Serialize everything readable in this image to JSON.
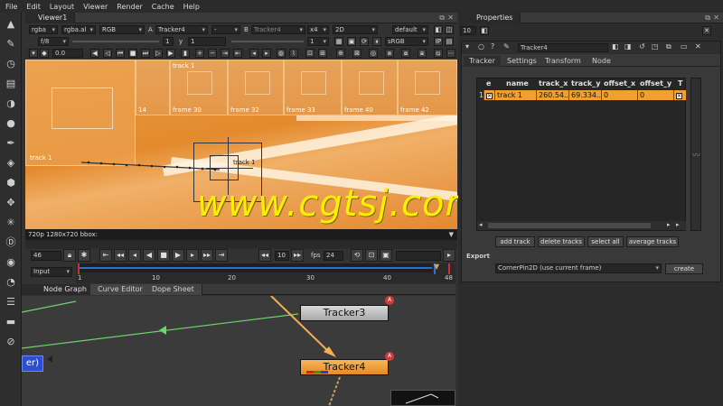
{
  "menu": [
    "File",
    "Edit",
    "Layout",
    "Viewer",
    "Render",
    "Cache",
    "Help"
  ],
  "viewer": {
    "tab_label": "Viewer1",
    "channels": "rgba",
    "alpha_channel": "rgba.al",
    "color": "RGB",
    "input_a_label": "A",
    "input_a": "Tracker4",
    "input_a_op": "-",
    "input_b_label": "B",
    "input_b": "Tracker4",
    "zoom": "x4",
    "view_mode": "2D",
    "lut": "default",
    "fstop": "f/8",
    "frame_a": "1",
    "y_label": "y",
    "y_value": "1",
    "frame_b": "1",
    "colorspace": "sRGB",
    "gain": "0.0",
    "status_text": "720p 1280x720 bbox:",
    "overlay_track_top": "track 1",
    "overlay_track_main": "track 1",
    "overlay_left_label": "track 1"
  },
  "thumbnails": [
    {
      "label": "14"
    },
    {
      "label": "frame 30"
    },
    {
      "label": "frame 32"
    },
    {
      "label": "frame 33"
    },
    {
      "label": "frame 40"
    },
    {
      "label": "frame 42"
    }
  ],
  "transport": {
    "current_frame": "46",
    "step": "10",
    "fps_label": "fps",
    "fps": "24",
    "input_mode": "Input",
    "timeline_ticks": [
      "1",
      "10",
      "20",
      "30",
      "40",
      "48"
    ]
  },
  "nodegraph": {
    "tabs": [
      "Node Graph",
      "Curve Editor",
      "Dope Sheet"
    ],
    "node_tracker3": "Tracker3",
    "node_tracker4": "Tracker4",
    "node_left_label": "er)",
    "badge": "A"
  },
  "properties": {
    "panel_title": "Properties",
    "max_panels": "10",
    "node_name": "Tracker4",
    "tabs": [
      "Tracker",
      "Settings",
      "Transform",
      "Node"
    ],
    "columns": [
      "e",
      "name",
      "track_x",
      "track_y",
      "offset_x",
      "offset_y",
      "T"
    ],
    "rows": [
      {
        "index": "1",
        "name": "track 1",
        "track_x": "260.54...",
        "track_y": "69.334...",
        "offset_x": "0",
        "offset_y": "0"
      }
    ],
    "buttons": [
      "add track",
      "delete tracks",
      "select all",
      "average tracks"
    ],
    "export_label": "Export",
    "export_option": "CornerPin2D (use current frame)",
    "create_label": "create"
  },
  "watermark": "www.cgtsj.com",
  "colors": {
    "accent_orange": "#f0a030",
    "node_gray": "#bdbdbd",
    "link_green": "#6fd36f",
    "watermark_yellow": "#ffee00",
    "timeline_blue": "#2a6fd8"
  }
}
